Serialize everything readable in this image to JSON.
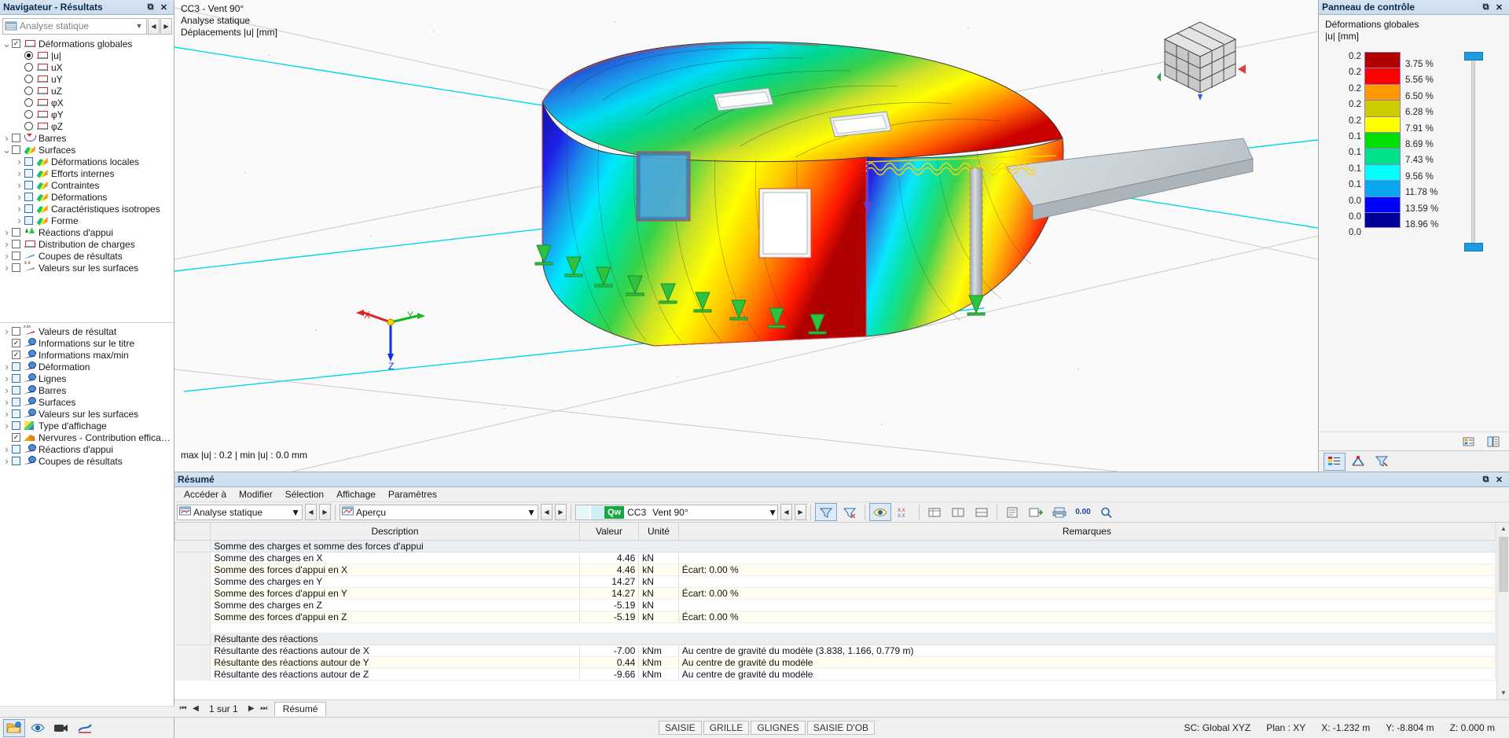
{
  "navigator": {
    "title": "Navigateur - Résultats",
    "window_buttons": [
      "restore-icon",
      "close-icon"
    ],
    "combo": {
      "value": "Analyse statique",
      "icon": "loadcase-icon"
    },
    "tree_top": [
      {
        "label": "Déformations globales",
        "indent": 0,
        "type": "checkbox",
        "checked": true,
        "expander": "down",
        "icon": "deformation-icon"
      },
      {
        "label": "|u|",
        "indent": 1,
        "type": "radio",
        "checked": true,
        "expander": "none",
        "icon": "deformation-icon"
      },
      {
        "label": "uX",
        "indent": 1,
        "type": "radio",
        "checked": false,
        "expander": "none",
        "icon": "deformation-icon"
      },
      {
        "label": "uY",
        "indent": 1,
        "type": "radio",
        "checked": false,
        "expander": "none",
        "icon": "deformation-icon"
      },
      {
        "label": "uZ",
        "indent": 1,
        "type": "radio",
        "checked": false,
        "expander": "none",
        "icon": "deformation-icon"
      },
      {
        "label": "φX",
        "indent": 1,
        "type": "radio",
        "checked": false,
        "expander": "none",
        "icon": "deformation-icon"
      },
      {
        "label": "φY",
        "indent": 1,
        "type": "radio",
        "checked": false,
        "expander": "none",
        "icon": "deformation-icon"
      },
      {
        "label": "φZ",
        "indent": 1,
        "type": "radio",
        "checked": false,
        "expander": "none",
        "icon": "deformation-icon"
      },
      {
        "label": "Barres",
        "indent": 0,
        "type": "checkbox",
        "checked": false,
        "expander": "right",
        "icon": "bars-icon"
      },
      {
        "label": "Surfaces",
        "indent": 0,
        "type": "checkbox",
        "checked": false,
        "expander": "down",
        "icon": "surface-icon"
      },
      {
        "label": "Déformations locales",
        "indent": 1,
        "type": "checkbox-blue",
        "checked": false,
        "expander": "right",
        "icon": "surface-icon"
      },
      {
        "label": "Efforts internes",
        "indent": 1,
        "type": "checkbox-blue",
        "checked": false,
        "expander": "right",
        "icon": "surface-icon"
      },
      {
        "label": "Contraintes",
        "indent": 1,
        "type": "checkbox-blue",
        "checked": false,
        "expander": "right",
        "icon": "surface-icon"
      },
      {
        "label": "Déformations",
        "indent": 1,
        "type": "checkbox-blue",
        "checked": false,
        "expander": "right",
        "icon": "surface-icon"
      },
      {
        "label": "Caractéristiques isotropes",
        "indent": 1,
        "type": "checkbox-blue",
        "checked": false,
        "expander": "right",
        "icon": "surface-icon"
      },
      {
        "label": "Forme",
        "indent": 1,
        "type": "checkbox-blue",
        "checked": false,
        "expander": "right",
        "icon": "surface-icon"
      },
      {
        "label": "Réactions d'appui",
        "indent": 0,
        "type": "checkbox",
        "checked": false,
        "expander": "right",
        "icon": "support-reaction-icon"
      },
      {
        "label": "Distribution de charges",
        "indent": 0,
        "type": "checkbox",
        "checked": false,
        "expander": "right",
        "icon": "deformation-icon"
      },
      {
        "label": "Coupes de résultats",
        "indent": 0,
        "type": "checkbox",
        "checked": false,
        "expander": "right",
        "icon": "result-section-icon"
      },
      {
        "label": "Valeurs sur les surfaces",
        "indent": 0,
        "type": "checkbox",
        "checked": false,
        "expander": "right",
        "icon": "surface-values-icon"
      }
    ],
    "tree_bottom": [
      {
        "label": "Valeurs de résultat",
        "indent": 0,
        "type": "checkbox",
        "checked": false,
        "expander": "right",
        "icon": "result-values-icon"
      },
      {
        "label": "Informations sur le titre",
        "indent": 0,
        "type": "checkbox",
        "checked": true,
        "expander": "none",
        "icon": "display-icon"
      },
      {
        "label": "Informations max/min",
        "indent": 0,
        "type": "checkbox",
        "checked": true,
        "expander": "none",
        "icon": "display-icon"
      },
      {
        "label": "Déformation",
        "indent": 0,
        "type": "checkbox-blue",
        "checked": false,
        "expander": "right",
        "icon": "display-icon"
      },
      {
        "label": "Lignes",
        "indent": 0,
        "type": "checkbox-blue",
        "checked": false,
        "expander": "right",
        "icon": "display-icon"
      },
      {
        "label": "Barres",
        "indent": 0,
        "type": "checkbox-blue",
        "checked": false,
        "expander": "right",
        "icon": "display-icon"
      },
      {
        "label": "Surfaces",
        "indent": 0,
        "type": "checkbox-blue",
        "checked": false,
        "expander": "right",
        "icon": "display-icon"
      },
      {
        "label": "Valeurs sur les surfaces",
        "indent": 0,
        "type": "checkbox-blue",
        "checked": false,
        "expander": "right",
        "icon": "display-icon"
      },
      {
        "label": "Type d'affichage",
        "indent": 0,
        "type": "checkbox-blue",
        "checked": false,
        "expander": "right",
        "icon": "display-type-icon"
      },
      {
        "label": "Nervures - Contribution efficace sur la...",
        "indent": 0,
        "type": "checkbox",
        "checked": true,
        "expander": "none",
        "icon": "rib-icon"
      },
      {
        "label": "Réactions d'appui",
        "indent": 0,
        "type": "checkbox-blue",
        "checked": false,
        "expander": "right",
        "icon": "display-icon"
      },
      {
        "label": "Coupes de résultats",
        "indent": 0,
        "type": "checkbox-blue",
        "checked": false,
        "expander": "right",
        "icon": "display-icon"
      }
    ],
    "toolbar": [
      {
        "name": "project-navigator-button",
        "icon": "folder-icon",
        "selected": true
      },
      {
        "name": "display-navigator-button",
        "icon": "eye-icon",
        "selected": false
      },
      {
        "name": "views-navigator-button",
        "icon": "camera-icon",
        "selected": false
      },
      {
        "name": "results-navigator-button",
        "icon": "results-icon",
        "selected": false
      }
    ]
  },
  "viewport": {
    "title_lines": "CC3 - Vent 90°\nAnalyse statique\nDéplacements |u| [mm]",
    "minmax": "max |u| : 0.2 | min |u| : 0.0 mm",
    "axis_labels": {
      "x": "X",
      "y": "Y",
      "z": "Z"
    },
    "view_cube": "view-cube-icon"
  },
  "control_panel": {
    "title": "Panneau de contrôle",
    "window_buttons": [
      "restore-icon",
      "close-icon"
    ],
    "header_lines": "Déformations globales\n|u| [mm]",
    "legend": {
      "values": [
        "0.2",
        "0.2",
        "0.2",
        "0.2",
        "0.2",
        "0.1",
        "0.1",
        "0.1",
        "0.1",
        "0.0",
        "0.0",
        "0.0"
      ],
      "percents": [
        "3.75 %",
        "5.56 %",
        "6.50 %",
        "6.28 %",
        "7.91 %",
        "8.69 %",
        "7.43 %",
        "9.56 %",
        "11.78 %",
        "13.59 %",
        "18.96 %"
      ],
      "colors": [
        "#b00000",
        "#ff0000",
        "#ff9900",
        "#cccc00",
        "#ffff00",
        "#00e000",
        "#00e28a",
        "#00ffff",
        "#0aa6ee",
        "#0000ff",
        "#000099"
      ]
    },
    "footer_buttons": [
      {
        "name": "legend-settings-button",
        "icon": "legend-icon"
      },
      {
        "name": "panel-options-button",
        "icon": "options-icon"
      }
    ],
    "tabs": [
      {
        "name": "tab-color-scale",
        "icon": "color-scale-icon",
        "selected": true
      },
      {
        "name": "tab-factors",
        "icon": "factors-icon",
        "selected": false
      },
      {
        "name": "tab-filter",
        "icon": "filter-icon",
        "selected": false
      }
    ]
  },
  "resume": {
    "title": "Résumé",
    "window_buttons": [
      "restore-icon",
      "close-icon"
    ],
    "menu": [
      "Accéder à",
      "Modifier",
      "Sélection",
      "Affichage",
      "Paramètres"
    ],
    "toolbar": {
      "analysis_combo": "Analyse statique",
      "view_combo": "Aperçu",
      "loadcase_tag": "Qw",
      "loadcase_id": "CC3",
      "loadcase_name": "Vent 90°",
      "number_format_button": "0.00",
      "search_button": "search-icon"
    },
    "columns": [
      "",
      "Description",
      "Valeur",
      "Unité",
      "Remarques"
    ],
    "sections": [
      {
        "title": "Somme des charges et somme des forces d'appui",
        "rows": [
          {
            "description": "Somme des charges en X",
            "valeur": "4.46",
            "unite": "kN",
            "remarques": ""
          },
          {
            "description": "Somme des forces d'appui en X",
            "valeur": "4.46",
            "unite": "kN",
            "remarques": "Écart: 0.00 %"
          },
          {
            "description": "Somme des charges en Y",
            "valeur": "14.27",
            "unite": "kN",
            "remarques": ""
          },
          {
            "description": "Somme des forces d'appui en Y",
            "valeur": "14.27",
            "unite": "kN",
            "remarques": "Écart: 0.00 %"
          },
          {
            "description": "Somme des charges en Z",
            "valeur": "-5.19",
            "unite": "kN",
            "remarques": ""
          },
          {
            "description": "Somme des forces d'appui en Z",
            "valeur": "-5.19",
            "unite": "kN",
            "remarques": "Écart: 0.00 %"
          }
        ]
      },
      {
        "title": "Résultante des réactions",
        "rows": [
          {
            "description": "Résultante des réactions autour de X",
            "valeur": "-7.00",
            "unite": "kNm",
            "remarques": "Au centre de gravité du modèle (3.838, 1.166, 0.779 m)"
          },
          {
            "description": "Résultante des réactions autour de Y",
            "valeur": "0.44",
            "unite": "kNm",
            "remarques": "Au centre de gravité du modèle"
          },
          {
            "description": "Résultante des réactions autour de Z",
            "valeur": "-9.66",
            "unite": "kNm",
            "remarques": "Au centre de gravité du modèle"
          }
        ]
      }
    ],
    "pager": "1 sur 1",
    "sheet_tab": "Résumé"
  },
  "statusbar": {
    "toggles": [
      "SAISIE",
      "GRILLE",
      "GLIGNES",
      "SAISIE D'OB"
    ],
    "coord_system": "SC: Global XYZ",
    "plane": "Plan : XY",
    "x": "X: -1.232 m",
    "y": "Y: -8.804 m",
    "z": "Z: 0.000 m"
  }
}
